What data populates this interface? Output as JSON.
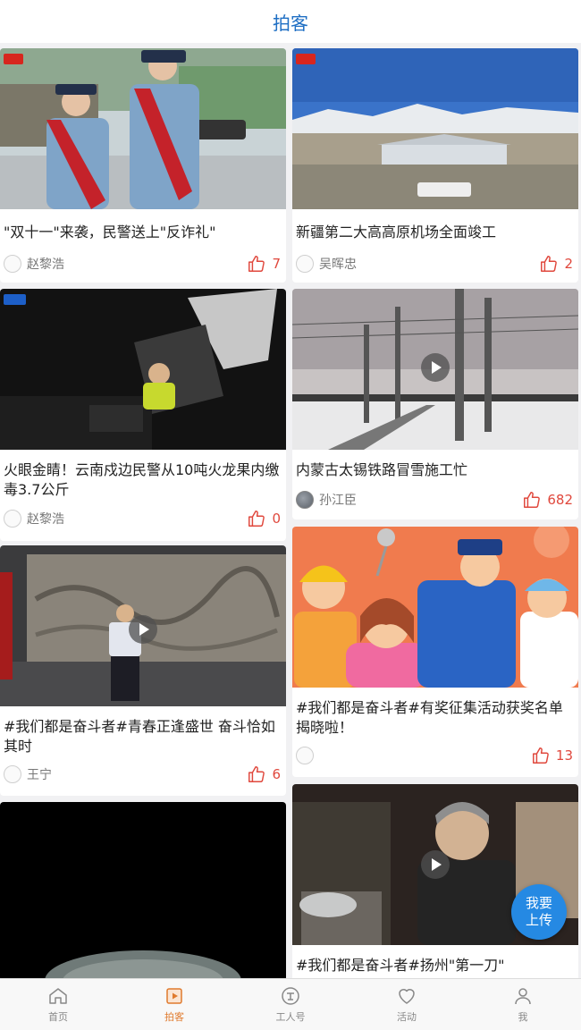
{
  "header": {
    "title": "拍客"
  },
  "cards": [
    {
      "title": "\"双十一\"来袭，民警送上\"反诈礼\"",
      "author": "赵黎浩",
      "likes": "7"
    },
    {
      "title": "新疆第二大高高原机场全面竣工",
      "author": "吴晖忠",
      "likes": "2"
    },
    {
      "title": "火眼金睛！云南戍边民警从10吨火龙果内缴毒3.7公斤",
      "author": "赵黎浩",
      "likes": "0"
    },
    {
      "title": "内蒙古太锡铁路冒雪施工忙",
      "author": "孙江臣",
      "likes": "682"
    },
    {
      "title": "#我们都是奋斗者#青春正逢盛世 奋斗恰如其时",
      "author": "王宁",
      "likes": "6"
    },
    {
      "title": "#我们都是奋斗者#有奖征集活动获奖名单揭晓啦！",
      "author": "",
      "likes": "13"
    },
    {
      "title": "",
      "author": "",
      "likes": ""
    },
    {
      "title": "#我们都是奋斗者#扬州\"第一刀\"",
      "author": "",
      "likes": ""
    }
  ],
  "fab": {
    "line1": "我要",
    "line2": "上传"
  },
  "tabs": [
    {
      "label": "首页",
      "icon": "home-icon"
    },
    {
      "label": "拍客",
      "icon": "camera-icon"
    },
    {
      "label": "工人号",
      "icon": "worker-icon"
    },
    {
      "label": "活动",
      "icon": "heart-icon"
    },
    {
      "label": "我",
      "icon": "profile-icon"
    }
  ],
  "colors": {
    "brand": "#1f6fc4",
    "like": "#e0483d",
    "active_tab": "#e07a2d",
    "fab": "#2589e3"
  }
}
